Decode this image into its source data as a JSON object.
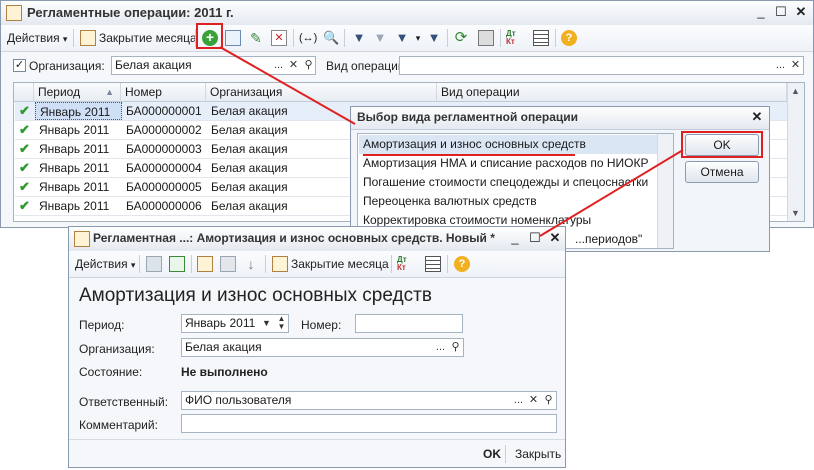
{
  "main": {
    "title": "Регламентные операции: 2011 г.",
    "toolbar": {
      "actions_label": "Действия",
      "close_month_label": "Закрытие месяца"
    },
    "filter": {
      "org_checked": true,
      "org_label": "Организация:",
      "org_value": "Белая акация",
      "op_label": "Вид операции",
      "op_value": "",
      "ellipsis": "...",
      "clear": "✕"
    },
    "table": {
      "headers": [
        "Период",
        "Номер",
        "Организация",
        "Вид операции"
      ],
      "rows": [
        {
          "period": "Январь 2011",
          "number": "БА000000001",
          "org": "Белая акация"
        },
        {
          "period": "Январь 2011",
          "number": "БА000000002",
          "org": "Белая акация"
        },
        {
          "period": "Январь 2011",
          "number": "БА000000003",
          "org": "Белая акация"
        },
        {
          "period": "Январь 2011",
          "number": "БА000000004",
          "org": "Белая акация"
        },
        {
          "period": "Январь 2011",
          "number": "БА000000005",
          "org": "Белая акация"
        },
        {
          "period": "Январь 2011",
          "number": "БА000000006",
          "org": "Белая акация"
        }
      ]
    }
  },
  "dialog": {
    "title": "Выбор вида регламентной операции",
    "items": [
      "Амортизация и износ основных средств",
      "Амортизация НМА и списание расходов по НИОКР",
      "Погашение стоимости спецодежды и спецоснастки",
      "Переоценка валютных средств",
      "Корректировка стоимости номенклатуры",
      "...периодов\""
    ],
    "selected_index": 0,
    "ok_label": "OK",
    "cancel_label": "Отмена"
  },
  "doc": {
    "title": "Регламентная ...: Амортизация и износ основных средств. Новый *",
    "toolbar": {
      "actions_label": "Действия",
      "close_month_label": "Закрытие месяца",
      "dtkt_label": "Дт Кт"
    },
    "heading": "Амортизация и износ основных средств",
    "period_label": "Период:",
    "period_value": "Январь 2011",
    "number_label": "Номер:",
    "number_value": "",
    "org_label": "Организация:",
    "org_value": "Белая акация",
    "state_label": "Состояние:",
    "state_value": "Не выполнено",
    "responsible_label": "Ответственный:",
    "responsible_value": "ФИО пользователя",
    "comment_label": "Комментарий:",
    "comment_value": "",
    "ok_label": "OK",
    "close_label": "Закрыть"
  },
  "icons": {
    "calendar": "calendar-icon",
    "add": "add-icon",
    "copy": "copy-icon",
    "edit": "edit-icon",
    "delete": "delete-icon",
    "search": "search-icon",
    "help": "help-icon"
  },
  "colors": {
    "highlight_red": "#e02020",
    "check_green": "#2e9b2e",
    "selection": "#dbe6f5"
  }
}
